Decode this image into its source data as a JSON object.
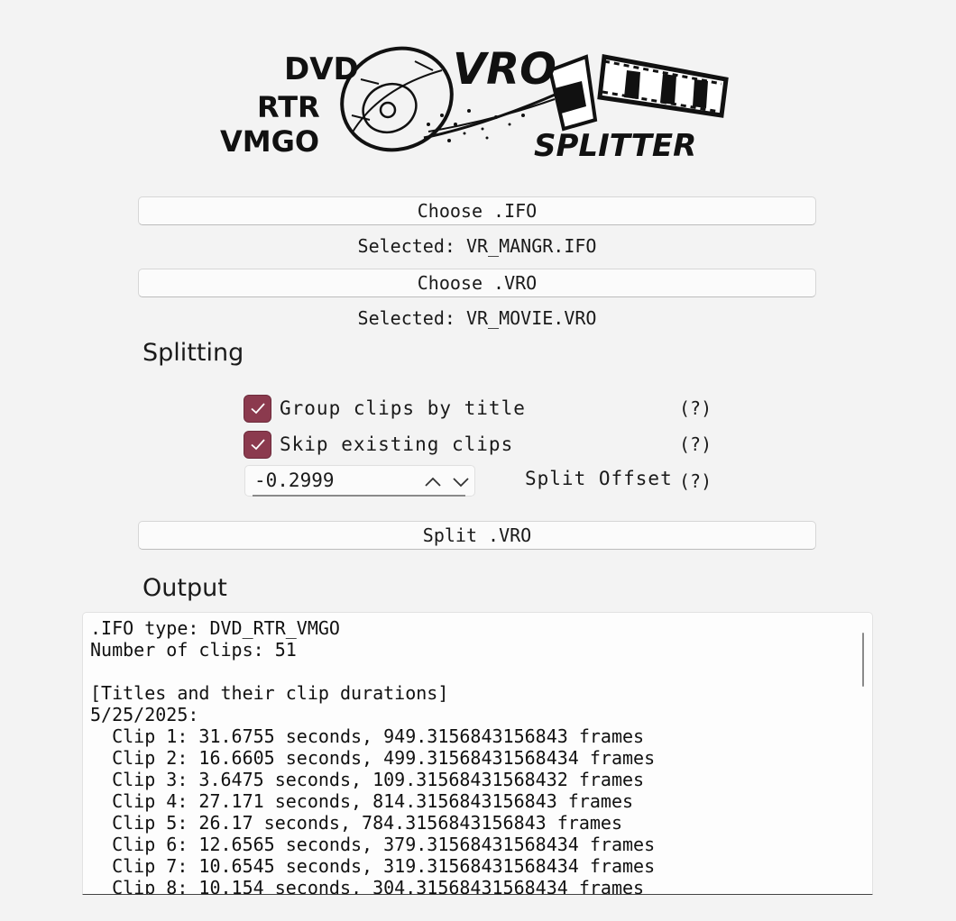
{
  "logo": {
    "text_left_1": "DVD",
    "text_left_2": "RTR",
    "text_left_3": "VMGO",
    "text_top": "VRO",
    "text_bottom": "SPLITTER"
  },
  "colors": {
    "accent": "#8b3a4e",
    "background": "#f3f3f3"
  },
  "ifo": {
    "button_label": "Choose .IFO",
    "selected_text": "Selected: VR_MANGR.IFO"
  },
  "vro": {
    "button_label": "Choose .VRO",
    "selected_text": "Selected: VR_MOVIE.VRO"
  },
  "splitting": {
    "title": "Splitting",
    "group_clips": {
      "label": "Group clips by title",
      "checked": true,
      "help": "(?)"
    },
    "skip_existing": {
      "label": "Skip existing clips",
      "checked": true,
      "help": "(?)"
    },
    "offset": {
      "value": "-0.2999",
      "label": "Split Offset",
      "help": "(?)"
    },
    "split_button_label": "Split .VRO"
  },
  "output": {
    "title": "Output",
    "lines": [
      ".IFO type: DVD_RTR_VMGO",
      "Number of clips: 51",
      "",
      "[Titles and their clip durations]",
      "5/25/2025:",
      "  Clip 1: 31.6755 seconds, 949.3156843156843 frames",
      "  Clip 2: 16.6605 seconds, 499.31568431568434 frames",
      "  Clip 3: 3.6475 seconds, 109.31568431568432 frames",
      "  Clip 4: 27.171 seconds, 814.3156843156843 frames",
      "  Clip 5: 26.17 seconds, 784.3156843156843 frames",
      "  Clip 6: 12.6565 seconds, 379.31568431568434 frames",
      "  Clip 7: 10.6545 seconds, 319.31568431568434 frames",
      "  Clip 8: 10.154 seconds, 304.31568431568434 frames"
    ]
  }
}
